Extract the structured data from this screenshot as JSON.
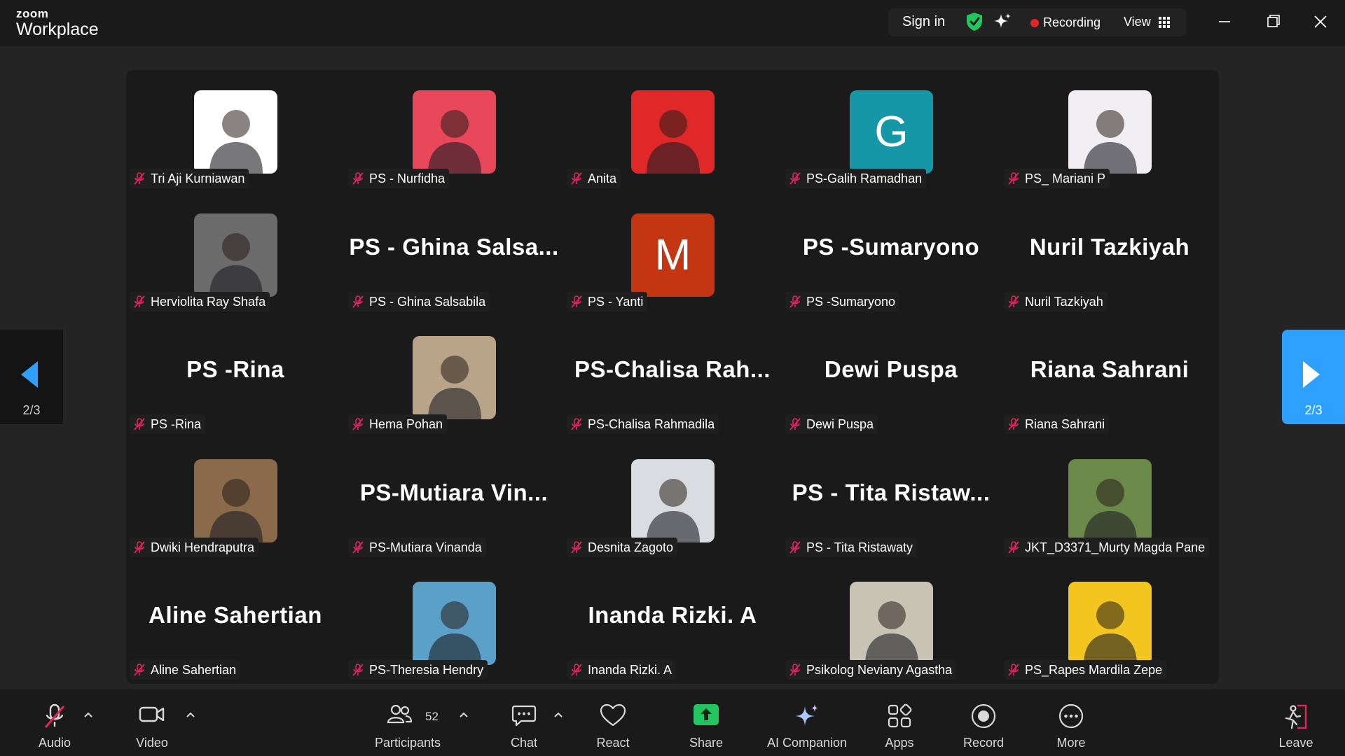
{
  "app": {
    "brand_top": "zoom",
    "brand_bottom": "Workplace"
  },
  "titlebar": {
    "sign_in": "Sign in",
    "recording": "Recording",
    "view": "View"
  },
  "colors": {
    "recording": "#e02828",
    "shield": "#22c55e",
    "share": "#22c55e",
    "pager_active": "#2ea0ff",
    "mute": "#e0245e"
  },
  "pager": {
    "left_count": "2/3",
    "right_count": "2/3"
  },
  "participants": [
    {
      "label": "Tri Aji Kurniawan",
      "avatar": "photo",
      "bg": "#ffffff"
    },
    {
      "label": "PS - Nurfidha",
      "avatar": "photo",
      "bg": "#e8475a"
    },
    {
      "label": "Anita",
      "avatar": "photo",
      "bg": "#e02828"
    },
    {
      "label": "PS-Galih Ramadhan",
      "avatar": "letter",
      "letter": "G",
      "bg": "#1597a8"
    },
    {
      "label": "PS_ Mariani P",
      "avatar": "photo",
      "bg": "#f1eef4"
    },
    {
      "label": "Herviolita Ray Shafa",
      "avatar": "photo",
      "bg": "#6b6b6b"
    },
    {
      "label": "PS - Ghina Salsabila",
      "avatar": "name",
      "big": "PS - Ghina Salsa..."
    },
    {
      "label": "PS - Yanti",
      "avatar": "letter",
      "letter": "M",
      "bg": "#c43612"
    },
    {
      "label": "PS -Sumaryono",
      "avatar": "name",
      "big": "PS -Sumaryono"
    },
    {
      "label": "Nuril Tazkiyah",
      "avatar": "name",
      "big": "Nuril Tazkiyah"
    },
    {
      "label": "PS -Rina",
      "avatar": "name",
      "big": "PS -Rina"
    },
    {
      "label": "Hema Pohan",
      "avatar": "photo",
      "bg": "#b9a48a"
    },
    {
      "label": "PS-Chalisa Rahmadila",
      "avatar": "name",
      "big": "PS-Chalisa Rah..."
    },
    {
      "label": "Dewi Puspa",
      "avatar": "name",
      "big": "Dewi Puspa"
    },
    {
      "label": "Riana Sahrani",
      "avatar": "name",
      "big": "Riana Sahrani"
    },
    {
      "label": "Dwiki Hendraputra",
      "avatar": "photo",
      "bg": "#8a6a4a"
    },
    {
      "label": "PS-Mutiara Vinanda",
      "avatar": "name",
      "big": "PS-Mutiara Vin..."
    },
    {
      "label": "Desnita Zagoto",
      "avatar": "photo",
      "bg": "#d9dde2"
    },
    {
      "label": "PS - Tita Ristawaty",
      "avatar": "name",
      "big": "PS - Tita Ristaw..."
    },
    {
      "label": "JKT_D3371_Murty Magda Pane",
      "avatar": "photo",
      "bg": "#6b8a4a"
    },
    {
      "label": "Aline Sahertian",
      "avatar": "name",
      "big": "Aline Sahertian"
    },
    {
      "label": "PS-Theresia Hendry",
      "avatar": "photo",
      "bg": "#5aa0c8"
    },
    {
      "label": "Inanda Rizki. A",
      "avatar": "name",
      "big": "Inanda Rizki. A"
    },
    {
      "label": "Psikolog Neviany Agastha",
      "avatar": "photo",
      "bg": "#c9c3b5"
    },
    {
      "label": "PS_Rapes Mardila Zepe",
      "avatar": "photo",
      "bg": "#f2c61f"
    }
  ],
  "toolbar": {
    "audio": "Audio",
    "video": "Video",
    "participants": "Participants",
    "participants_count": "52",
    "chat": "Chat",
    "react": "React",
    "share": "Share",
    "ai_companion": "AI Companion",
    "apps": "Apps",
    "record": "Record",
    "more": "More",
    "leave": "Leave"
  }
}
